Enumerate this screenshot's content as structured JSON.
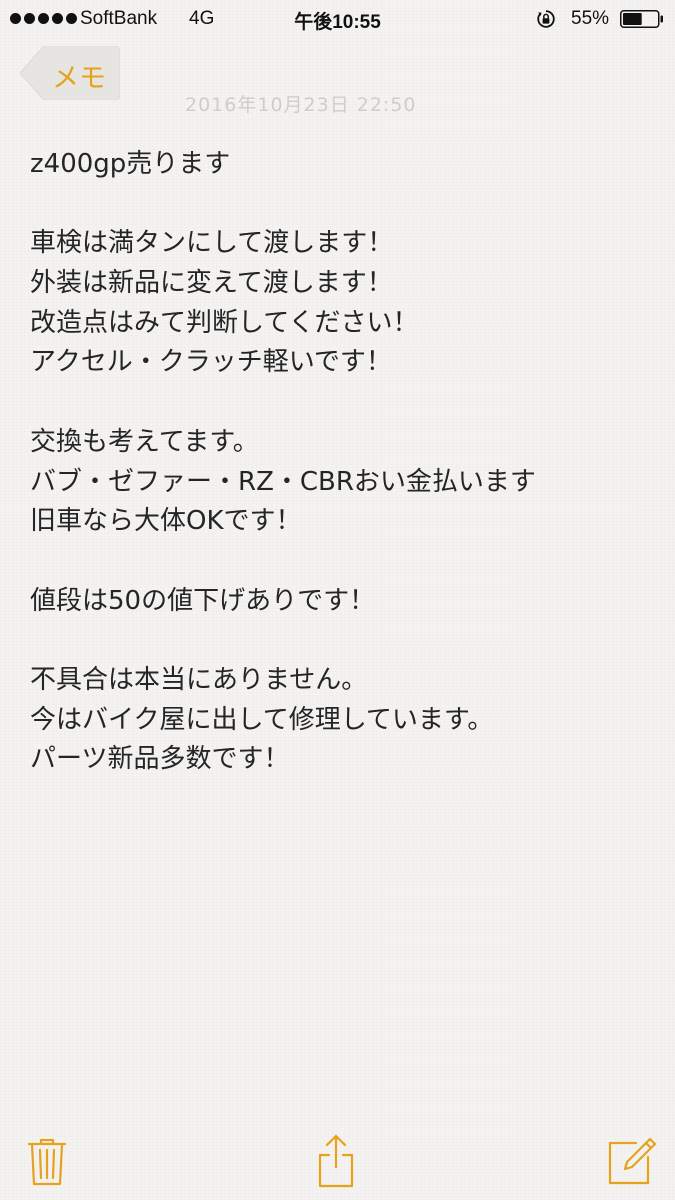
{
  "status_bar": {
    "carrier": "SoftBank",
    "network": "4G",
    "time": "午後10:55",
    "battery_percent": "55%",
    "battery_level": 0.55,
    "icons": [
      "signal-dots-icon",
      "rotation-lock-icon",
      "battery-icon"
    ]
  },
  "nav": {
    "back_label": "メモ",
    "date_text": "2016年10月23日 22:50"
  },
  "note": {
    "lines": [
      "z400gp売ります",
      "",
      "車検は満タンにして渡します！",
      "外装は新品に変えて渡します！",
      "改造点はみて判断してください！",
      "アクセル・クラッチ軽いです！",
      "",
      "交換も考えてます。",
      "バブ・ゼファー・RZ・CBRおい金払います",
      "旧車なら大体OKです！",
      "",
      "値段は50の値下げありです！",
      "",
      "不具合は本当にありません。",
      "今はバイク屋に出して修理しています。",
      "パーツ新品多数です！"
    ]
  },
  "toolbar": {
    "icons": [
      "trash-icon",
      "share-icon",
      "compose-icon"
    ]
  },
  "colors": {
    "accent": "#e5a21a",
    "background": "#f4f3f1",
    "text": "#252525",
    "date_text": "#cfcdca"
  }
}
